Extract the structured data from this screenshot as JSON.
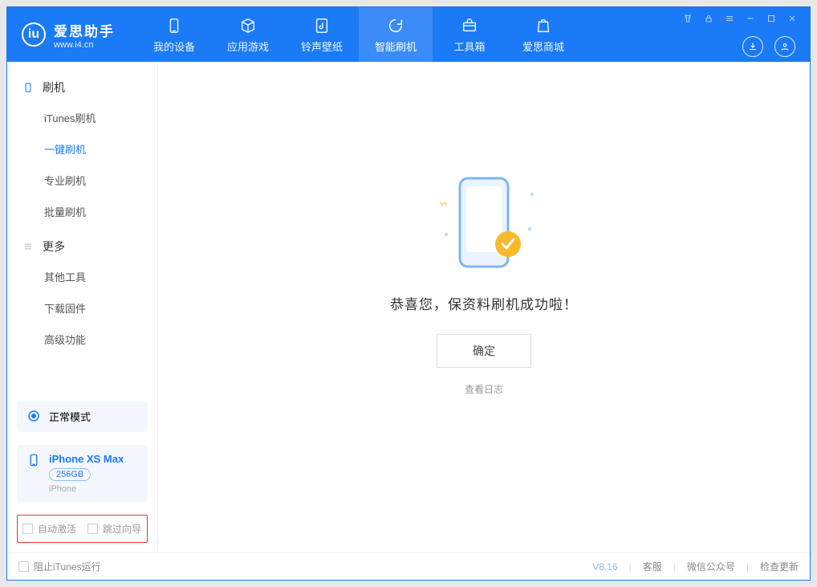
{
  "app": {
    "name": "爱思助手",
    "domain": "www.i4.cn"
  },
  "nav": [
    {
      "id": "device",
      "label": "我的设备"
    },
    {
      "id": "apps",
      "label": "应用游戏"
    },
    {
      "id": "ring",
      "label": "铃声壁纸"
    },
    {
      "id": "flash",
      "label": "智能刷机"
    },
    {
      "id": "tools",
      "label": "工具箱"
    },
    {
      "id": "store",
      "label": "爱思商城"
    }
  ],
  "sidebar": {
    "flash_section": "刷机",
    "flash_items": [
      {
        "id": "itunes",
        "label": "iTunes刷机"
      },
      {
        "id": "oneclick",
        "label": "一键刷机",
        "active": true
      },
      {
        "id": "pro",
        "label": "专业刷机"
      },
      {
        "id": "batch",
        "label": "批量刷机"
      }
    ],
    "more_section": "更多",
    "more_items": [
      {
        "id": "other",
        "label": "其他工具"
      },
      {
        "id": "fw",
        "label": "下载固件"
      },
      {
        "id": "adv",
        "label": "高级功能"
      }
    ],
    "mode": "正常模式",
    "device": {
      "name": "iPhone XS Max",
      "capacity": "256GB",
      "type": "iPhone"
    },
    "checks": {
      "auto_activate": "自动激活",
      "skip_guide": "跳过向导"
    }
  },
  "main": {
    "success_text": "恭喜您，保资料刷机成功啦！",
    "ok_label": "确定",
    "log_label": "查看日志"
  },
  "footer": {
    "block_itunes": "阻止iTunes运行",
    "version": "V8.16",
    "links": [
      "客服",
      "微信公众号",
      "检查更新"
    ]
  }
}
